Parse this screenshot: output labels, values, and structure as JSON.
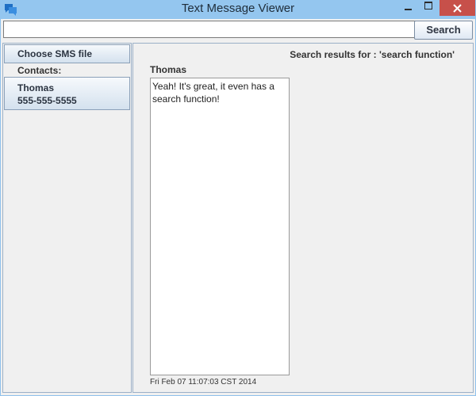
{
  "window": {
    "title": "Text Message Viewer",
    "accent_color": "#94c6ef",
    "close_color": "#c7504a"
  },
  "toolbar": {
    "search_value": "",
    "search_button_label": "Search"
  },
  "sidebar": {
    "choose_file_label": "Choose SMS file",
    "contacts_label": "Contacts:",
    "contacts": [
      {
        "name": "Thomas",
        "phone": "555-555-5555"
      }
    ]
  },
  "results": {
    "title": "Search results for : 'search function'",
    "messages": [
      {
        "sender": "Thomas",
        "text": "Yeah! It's great, it even has a search function!",
        "timestamp": "Fri Feb 07 11:07:03 CST 2014"
      }
    ]
  },
  "icons": {
    "app": "chat-bubbles-icon",
    "minimize": "minimize-icon",
    "maximize": "maximize-icon",
    "close": "close-icon"
  }
}
